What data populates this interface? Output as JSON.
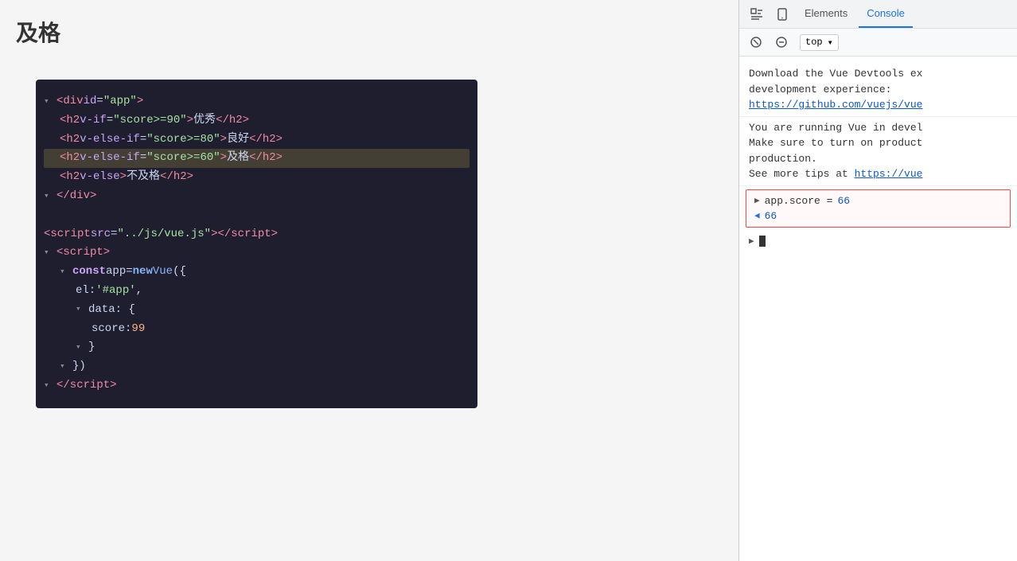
{
  "page": {
    "title": "及格"
  },
  "devtools": {
    "tabs": [
      "Elements",
      "Console"
    ],
    "active_tab": "Console",
    "context": "top",
    "messages": [
      {
        "id": 1,
        "text": "Download the Vue Devtools ex\ndevelopment experience:",
        "link_text": "https://github.com/vuejs/vue",
        "link_url": "#"
      },
      {
        "id": 2,
        "text": "You are running Vue in devel\nMake sure to turn on product\nproduction.\nSee more tips at ",
        "link_text": "https://vue",
        "link_url": "#"
      }
    ],
    "console_input_label": "app.score = 66",
    "console_result": "66"
  },
  "code": {
    "lines": [
      {
        "indent": 0,
        "fold": true,
        "content": "<div id=\"app\">"
      },
      {
        "indent": 1,
        "fold": false,
        "highlight": false,
        "content": "<h2 v-if=\"score>=90\">优秀</h2>"
      },
      {
        "indent": 1,
        "fold": false,
        "highlight": false,
        "content": "<h2 v-else-if=\"score>=80\">良好</h2>"
      },
      {
        "indent": 1,
        "fold": false,
        "highlight": true,
        "content": "<h2 v-else-if=\"score>=60\">及格</h2>"
      },
      {
        "indent": 1,
        "fold": false,
        "highlight": false,
        "content": "<h2 v-else>不及格</h2>"
      },
      {
        "indent": 0,
        "fold": true,
        "content": "</div>"
      },
      {
        "indent": 0,
        "fold": false,
        "blank": true
      },
      {
        "indent": 0,
        "fold": false,
        "content": "<script src=\"../js/vue.js\"><\\/script>"
      },
      {
        "indent": 0,
        "fold": true,
        "content": "<script>"
      },
      {
        "indent": 1,
        "fold": true,
        "content": "const app = new Vue({"
      },
      {
        "indent": 2,
        "fold": false,
        "content": "el: '#app',"
      },
      {
        "indent": 2,
        "fold": true,
        "content": "data: {"
      },
      {
        "indent": 3,
        "fold": false,
        "content": "score: 99"
      },
      {
        "indent": 2,
        "fold": true,
        "content": "}"
      },
      {
        "indent": 1,
        "fold": true,
        "content": "})"
      },
      {
        "indent": 0,
        "fold": true,
        "content": "<\\/script>"
      }
    ]
  },
  "icons": {
    "inspect": "⬚",
    "device": "▭",
    "play": "▶",
    "block": "⊘",
    "chevron": "▾"
  }
}
